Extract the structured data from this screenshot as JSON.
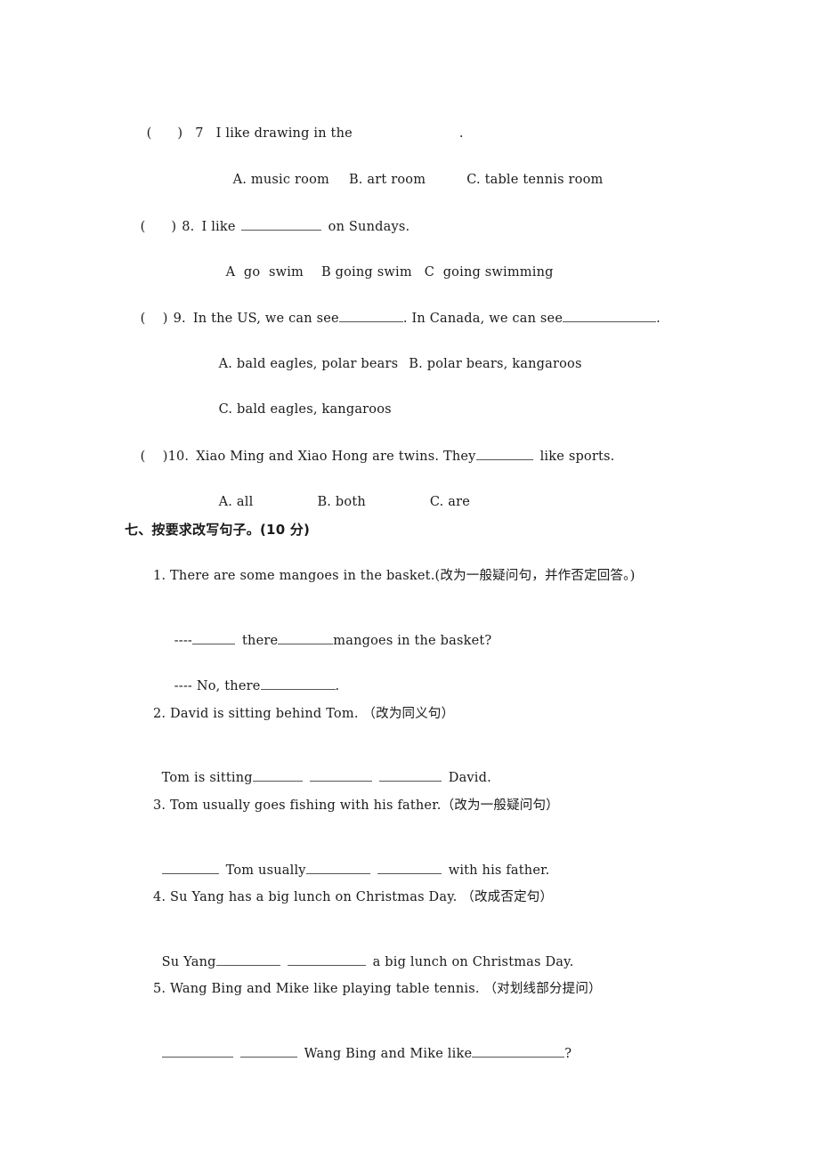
{
  "questions_mc": [
    {
      "paren": "(      )",
      "number": "7",
      "stem_before": "I like drawing in the",
      "stem_after": ".",
      "options": [
        "A. music room",
        "B. art room",
        "C. table tennis room"
      ]
    },
    {
      "paren": "(      )",
      "number": "8.",
      "stem_before": "I like",
      "stem_after": "on Sundays.",
      "options": [
        "A  go  swim",
        "B going swim",
        "C  going swimming"
      ]
    },
    {
      "paren": "(    )",
      "number": "9.",
      "stem_part1": "In the US, we can see",
      "stem_part2": ". In Canada, we can see",
      "stem_after": ".",
      "options": [
        "A. bald eagles, polar bears",
        "B. polar bears, kangaroos",
        "C. bald eagles, kangaroos"
      ]
    },
    {
      "paren": "(    )",
      "number": "10.",
      "stem_before": "Xiao Ming and Xiao Hong are twins. They",
      "stem_after": "like sports.",
      "options": [
        "A. all",
        "B. both",
        "C. are"
      ]
    }
  ],
  "section7": {
    "heading": "七、按要求改写句子。(10 分)",
    "items": [
      {
        "prompt": "1. There are some mangoes in the basket.(改为一般疑问句，并作否定回答。)",
        "answer_line1_prefix": "----",
        "answer_line1_mid": "there",
        "answer_line1_after": "mangoes in the basket?",
        "answer_line2_prefix": "---- No, there",
        "answer_line2_after": "."
      },
      {
        "prompt": "2. David is sitting behind Tom. （改为同义句）",
        "answer_before": "Tom is sitting",
        "answer_after": "David."
      },
      {
        "prompt": "3. Tom usually goes fishing with his father.（改为一般疑问句）",
        "answer_mid": "Tom usually",
        "answer_after": "with his father."
      },
      {
        "prompt": "4. Su Yang has a big lunch on Christmas Day. （改成否定句）",
        "answer_before": "Su Yang",
        "answer_after": "a big lunch on Christmas Day."
      },
      {
        "prompt": "5. Wang Bing and Mike like playing table tennis. （对划线部分提问）",
        "answer_mid": "Wang Bing and Mike like",
        "answer_after": "?"
      }
    ]
  }
}
